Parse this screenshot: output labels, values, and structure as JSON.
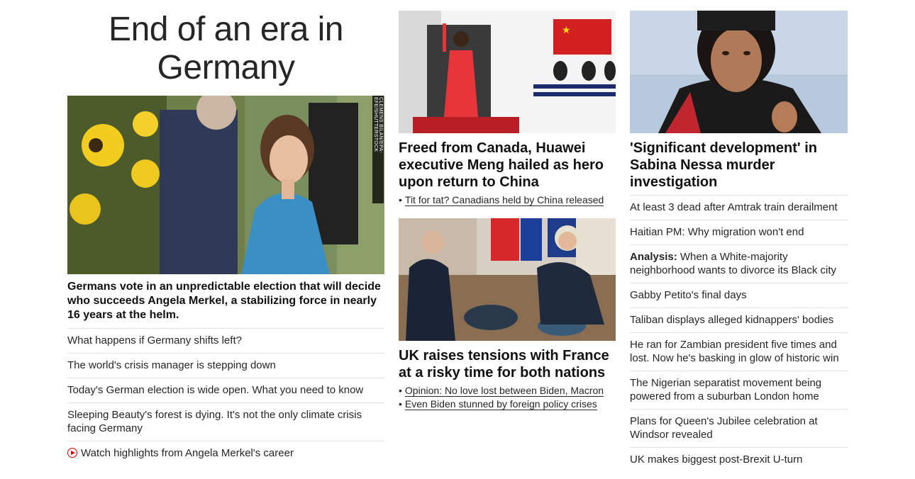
{
  "main": {
    "headline": "End of an era in Germany",
    "photo_credit": "CLEMENS BILAN/EPA-EFE/SHUTTERSTOCK",
    "lead_text": "Germans vote in an unpredictable election that will decide who succeeds Angela Merkel, a stabilizing force in nearly 16 years at the helm.",
    "links": [
      "What happens if Germany shifts left?",
      "The world's crisis manager is stepping down",
      "Today's German election is wide open. What you need to know",
      "Sleeping Beauty's forest is dying. It's not the only climate crisis facing Germany"
    ],
    "video_link": "Watch highlights from Angela Merkel's career"
  },
  "middle": {
    "story1": {
      "title": "Freed from Canada, Huawei executive Meng hailed as hero upon return to China",
      "bullets": [
        "Tit for tat? Canadians held by China released"
      ]
    },
    "story2": {
      "title": "UK raises tensions with France at a risky time for both nations",
      "bullets": [
        "Opinion: No love lost between Biden, Macron",
        "Even Biden stunned by foreign policy crises"
      ]
    }
  },
  "right": {
    "title": "'Significant development' in Sabina Nessa murder investigation",
    "links": [
      {
        "label": "",
        "text": "At least 3 dead after Amtrak train derailment"
      },
      {
        "label": "",
        "text": "Haitian PM: Why migration won't end"
      },
      {
        "label": "Analysis:",
        "text": " When a White-majority neighborhood wants to divorce its Black city"
      },
      {
        "label": "",
        "text": "Gabby Petito's final days"
      },
      {
        "label": "",
        "text": "Taliban displays alleged kidnappers' bodies"
      },
      {
        "label": "",
        "text": "He ran for Zambian president five times and lost. Now he's basking in glow of historic win"
      },
      {
        "label": "",
        "text": "The Nigerian separatist movement being powered from a suburban London home"
      },
      {
        "label": "",
        "text": "Plans for Queen's Jubilee celebration at Windsor revealed"
      },
      {
        "label": "",
        "text": "UK makes biggest post-Brexit U-turn"
      }
    ]
  }
}
